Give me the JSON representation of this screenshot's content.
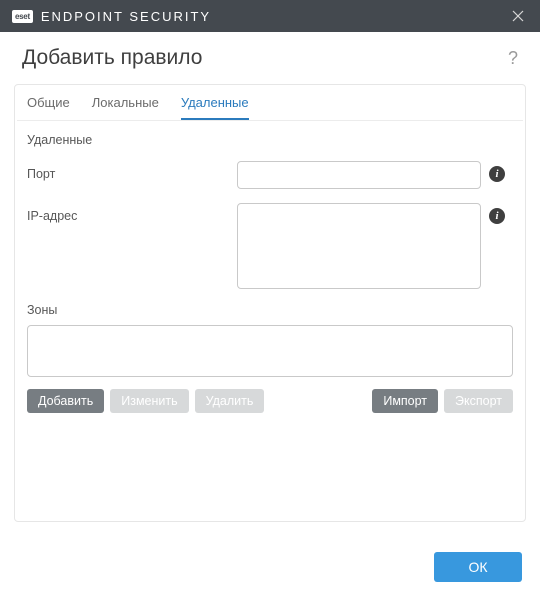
{
  "titlebar": {
    "logo_text": "eset",
    "product_name": "ENDPOINT SECURITY"
  },
  "header": {
    "title": "Добавить правило",
    "help": "?"
  },
  "tabs": [
    {
      "label": "Общие",
      "active": false
    },
    {
      "label": "Локальные",
      "active": false
    },
    {
      "label": "Удаленные",
      "active": true
    }
  ],
  "section": {
    "title": "Удаленные",
    "port": {
      "label": "Порт",
      "value": ""
    },
    "ip": {
      "label": "IP-адрес",
      "value": ""
    },
    "zones": {
      "label": "Зоны",
      "value": ""
    }
  },
  "buttons": {
    "add": "Добавить",
    "edit": "Изменить",
    "delete": "Удалить",
    "import": "Импорт",
    "export": "Экспорт"
  },
  "footer": {
    "ok": "ОК"
  }
}
